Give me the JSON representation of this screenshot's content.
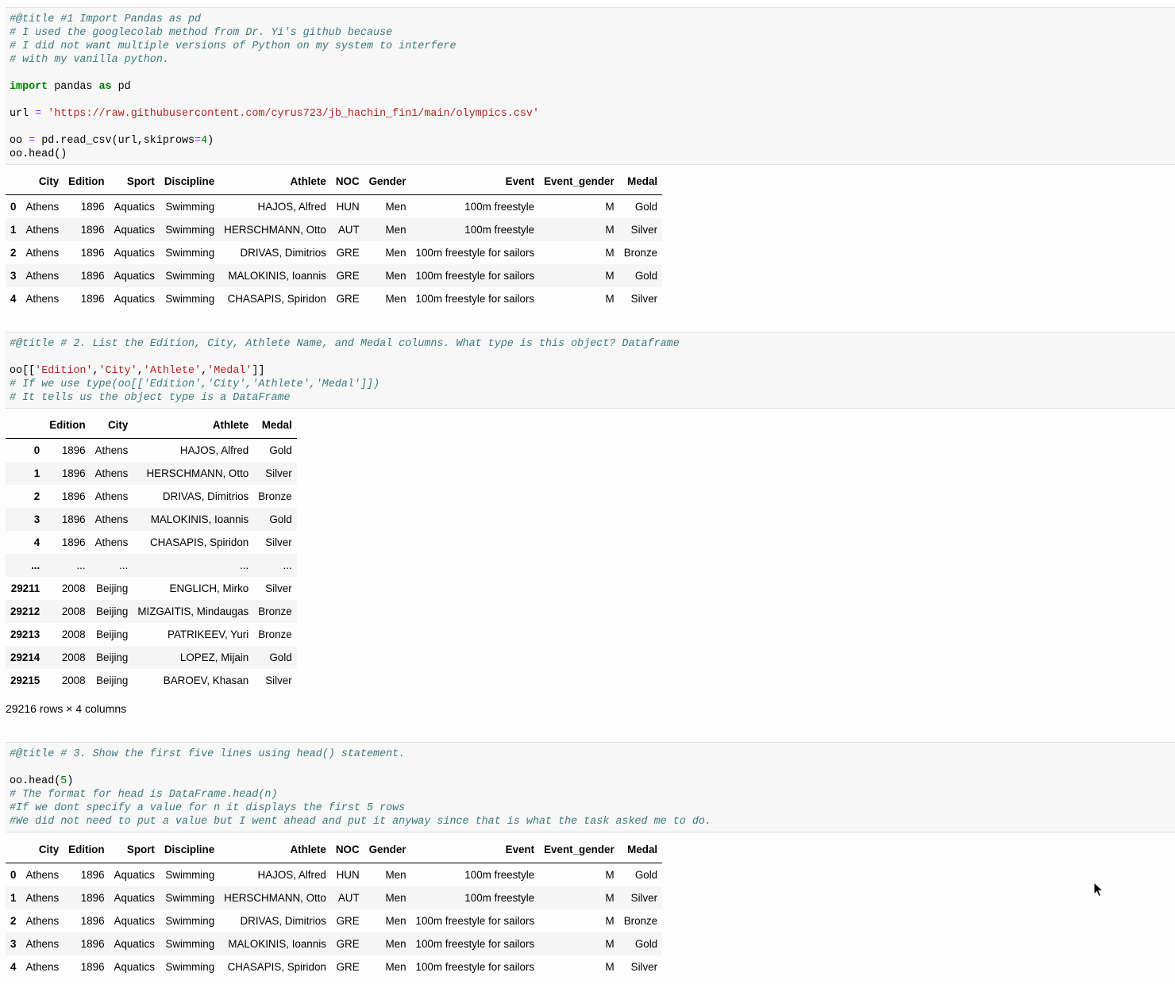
{
  "cell1": {
    "comment_lines": [
      "#@title #1 Import Pandas as pd",
      "# I used the googlecolab method from Dr. Yi's github because",
      "# I did not want multiple versions of Python on my system to interfere",
      "# with my vanilla python."
    ],
    "import_kw": "import",
    "import_mod": " pandas ",
    "as_kw": "as",
    "import_alias": " pd",
    "url_var": "url ",
    "eq": "=",
    "url_value": " 'https://raw.githubusercontent.com/cyrus723/jb_hachin_fin1/main/olympics.csv'",
    "read_pre": "oo ",
    "read_mid": " pd.read_csv(url,skiprows",
    "read_num": "4",
    "read_post": ")",
    "head_line": "oo.head()"
  },
  "table1": {
    "columns": [
      "",
      "City",
      "Edition",
      "Sport",
      "Discipline",
      "Athlete",
      "NOC",
      "Gender",
      "Event",
      "Event_gender",
      "Medal"
    ],
    "rows": [
      [
        "0",
        "Athens",
        "1896",
        "Aquatics",
        "Swimming",
        "HAJOS, Alfred",
        "HUN",
        "Men",
        "100m freestyle",
        "M",
        "Gold"
      ],
      [
        "1",
        "Athens",
        "1896",
        "Aquatics",
        "Swimming",
        "HERSCHMANN, Otto",
        "AUT",
        "Men",
        "100m freestyle",
        "M",
        "Silver"
      ],
      [
        "2",
        "Athens",
        "1896",
        "Aquatics",
        "Swimming",
        "DRIVAS, Dimitrios",
        "GRE",
        "Men",
        "100m freestyle for sailors",
        "M",
        "Bronze"
      ],
      [
        "3",
        "Athens",
        "1896",
        "Aquatics",
        "Swimming",
        "MALOKINIS, Ioannis",
        "GRE",
        "Men",
        "100m freestyle for sailors",
        "M",
        "Gold"
      ],
      [
        "4",
        "Athens",
        "1896",
        "Aquatics",
        "Swimming",
        "CHASAPIS, Spiridon",
        "GRE",
        "Men",
        "100m freestyle for sailors",
        "M",
        "Silver"
      ]
    ]
  },
  "cell2": {
    "title_comment": "#@title # 2. List the Edition, City, Athlete Name, and Medal columns. What type is this object? Dataframe",
    "select_pre": "oo[[",
    "s1": "'Edition'",
    "s2": "'City'",
    "s3": "'Athlete'",
    "s4": "'Medal'",
    "comma": ",",
    "select_post": "]]",
    "comment2": "# If we use type(oo[['Edition','City','Athlete','Medal']])",
    "comment3": "# It tells us the object type is a DataFrame"
  },
  "table2": {
    "columns": [
      "",
      "Edition",
      "City",
      "Athlete",
      "Medal"
    ],
    "rows": [
      [
        "0",
        "1896",
        "Athens",
        "HAJOS, Alfred",
        "Gold"
      ],
      [
        "1",
        "1896",
        "Athens",
        "HERSCHMANN, Otto",
        "Silver"
      ],
      [
        "2",
        "1896",
        "Athens",
        "DRIVAS, Dimitrios",
        "Bronze"
      ],
      [
        "3",
        "1896",
        "Athens",
        "MALOKINIS, Ioannis",
        "Gold"
      ],
      [
        "4",
        "1896",
        "Athens",
        "CHASAPIS, Spiridon",
        "Silver"
      ],
      [
        "...",
        "...",
        "...",
        "...",
        "..."
      ],
      [
        "29211",
        "2008",
        "Beijing",
        "ENGLICH, Mirko",
        "Silver"
      ],
      [
        "29212",
        "2008",
        "Beijing",
        "MIZGAITIS, Mindaugas",
        "Bronze"
      ],
      [
        "29213",
        "2008",
        "Beijing",
        "PATRIKEEV, Yuri",
        "Bronze"
      ],
      [
        "29214",
        "2008",
        "Beijing",
        "LOPEZ, Mijain",
        "Gold"
      ],
      [
        "29215",
        "2008",
        "Beijing",
        "BAROEV, Khasan",
        "Silver"
      ]
    ],
    "shape_text": "29216 rows × 4 columns"
  },
  "cell3": {
    "title_comment": "#@title # 3. Show the first five lines using head() statement.",
    "head_pre": "oo.head(",
    "head_num": "5",
    "head_post": ")",
    "comment2": "# The format for head is DataFrame.head(n)",
    "comment3": "#If we dont specify a value for n it displays the first 5 rows",
    "comment4": "#We did not need to put a value but I went ahead and put it anyway since that is what the task asked me to do."
  },
  "table3": {
    "columns": [
      "",
      "City",
      "Edition",
      "Sport",
      "Discipline",
      "Athlete",
      "NOC",
      "Gender",
      "Event",
      "Event_gender",
      "Medal"
    ],
    "rows": [
      [
        "0",
        "Athens",
        "1896",
        "Aquatics",
        "Swimming",
        "HAJOS, Alfred",
        "HUN",
        "Men",
        "100m freestyle",
        "M",
        "Gold"
      ],
      [
        "1",
        "Athens",
        "1896",
        "Aquatics",
        "Swimming",
        "HERSCHMANN, Otto",
        "AUT",
        "Men",
        "100m freestyle",
        "M",
        "Silver"
      ],
      [
        "2",
        "Athens",
        "1896",
        "Aquatics",
        "Swimming",
        "DRIVAS, Dimitrios",
        "GRE",
        "Men",
        "100m freestyle for sailors",
        "M",
        "Bronze"
      ],
      [
        "3",
        "Athens",
        "1896",
        "Aquatics",
        "Swimming",
        "MALOKINIS, Ioannis",
        "GRE",
        "Men",
        "100m freestyle for sailors",
        "M",
        "Gold"
      ],
      [
        "4",
        "Athens",
        "1896",
        "Aquatics",
        "Swimming",
        "CHASAPIS, Spiridon",
        "GRE",
        "Men",
        "100m freestyle for sailors",
        "M",
        "Silver"
      ]
    ]
  },
  "cursor": {
    "icon": "mouse-pointer-icon"
  }
}
